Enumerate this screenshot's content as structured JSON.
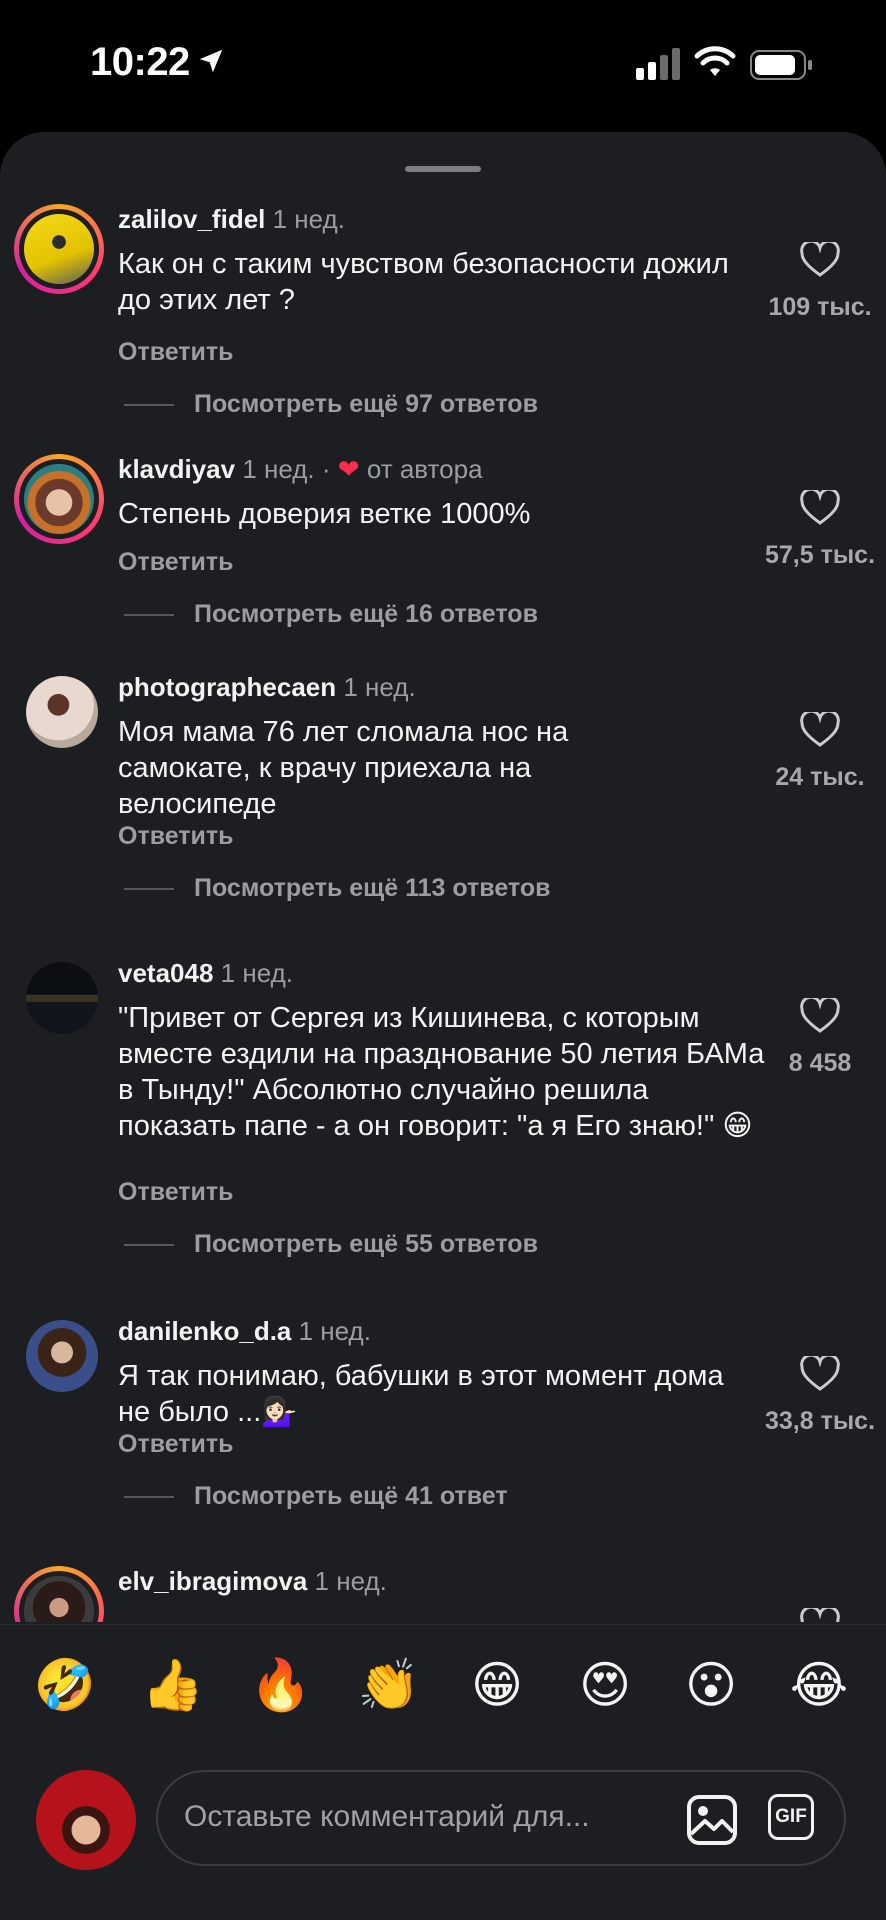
{
  "status_bar": {
    "time": "10:22"
  },
  "comments": [
    {
      "username": "zalilov_fidel",
      "age": "1 нед.",
      "author_like": "",
      "text": "Как он с таким чувством безопасности дожил до этих лет ?",
      "reply_label": "Ответить",
      "likes": "109 тыс.",
      "more_replies": "Посмотреть ещё 97 ответов",
      "has_story_ring": true
    },
    {
      "username": "klavdiyav",
      "age": "1 нед. ·",
      "author_like": "от автора",
      "text": "Степень доверия ветке 1000%",
      "reply_label": "Ответить",
      "likes": "57,5 тыс.",
      "more_replies": "Посмотреть ещё 16 ответов",
      "has_story_ring": true
    },
    {
      "username": "photographecaen",
      "age": "1 нед.",
      "author_like": "",
      "text": "Моя мама 76 лет сломала нос на самокате, к врачу приехала на велосипеде",
      "reply_label": "Ответить",
      "likes": "24 тыс.",
      "more_replies": "Посмотреть ещё 113 ответов",
      "has_story_ring": false
    },
    {
      "username": "veta048",
      "age": "1 нед.",
      "author_like": "",
      "text": "\"Привет от Сергея из Кишинева, с которым вместе ездили на празднование 50 летия БАМа в Тынду!\" Абсолютно случайно решила показать папе - а он говорит: \"а я Его знаю!\" 😁",
      "reply_label": "Ответить",
      "likes": "8 458",
      "more_replies": "Посмотреть ещё 55 ответов",
      "has_story_ring": false
    },
    {
      "username": "danilenko_d.a",
      "age": "1 нед.",
      "author_like": "",
      "text": "Я так понимаю, бабушки в этот момент дома не было ...💁🏻‍♀️",
      "reply_label": "Ответить",
      "likes": "33,8 тыс.",
      "more_replies": "Посмотреть ещё 41 ответ",
      "has_story_ring": false
    },
    {
      "username": "elv_ibragimova",
      "age": "1 нед.",
      "author_like": "",
      "text": "",
      "reply_label": "",
      "likes": "",
      "more_replies": "",
      "has_story_ring": true
    }
  ],
  "emoji_bar": [
    "🤣",
    "👍",
    "🔥",
    "👏",
    "😁",
    "😍",
    "😮",
    "😂"
  ],
  "composer": {
    "placeholder": "Оставьте комментарий для...",
    "gif_label": "GIF"
  },
  "colors": {
    "sheet_bg": "#1c1e21",
    "heart_red": "#ff2d4b",
    "muted": "#9a9da2"
  }
}
